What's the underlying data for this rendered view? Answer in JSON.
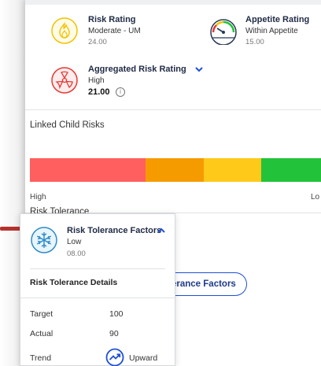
{
  "risk_rating": {
    "title": "Risk Rating",
    "level": "Moderate - UM",
    "value": "24.00"
  },
  "appetite_rating": {
    "title": "Appetite Rating",
    "level": "Within Appetite",
    "value": "15.00"
  },
  "aggregated": {
    "title": "Aggregated Risk Rating",
    "level": "High",
    "value": "21.00",
    "info_glyph": "i"
  },
  "linked_child": {
    "title": "Linked Child Risks",
    "segments": [
      {
        "color": "#ff5f5f"
      },
      {
        "color": "#f59b00"
      },
      {
        "color": "#ffc91a"
      },
      {
        "color": "#22c33a"
      }
    ],
    "label_high": "High",
    "label_low": "Lo"
  },
  "tolerance": {
    "title": "Risk Tolerance",
    "button_label": "erance Factors",
    "popup": {
      "title": "Risk Tolerance Factors",
      "level": "Low",
      "value": "08.00",
      "details_title": "Risk Tolerance Details",
      "rows": [
        {
          "label": "Target",
          "value": "100"
        },
        {
          "label": "Actual",
          "value": "90"
        },
        {
          "label": "Trend",
          "value": "Upward"
        }
      ]
    }
  },
  "colors": {
    "accent": "#1e4fd6",
    "risk_icon": "#f2c200",
    "aggregated_icon": "#e53935",
    "snow_icon": "#2d8bc7"
  }
}
